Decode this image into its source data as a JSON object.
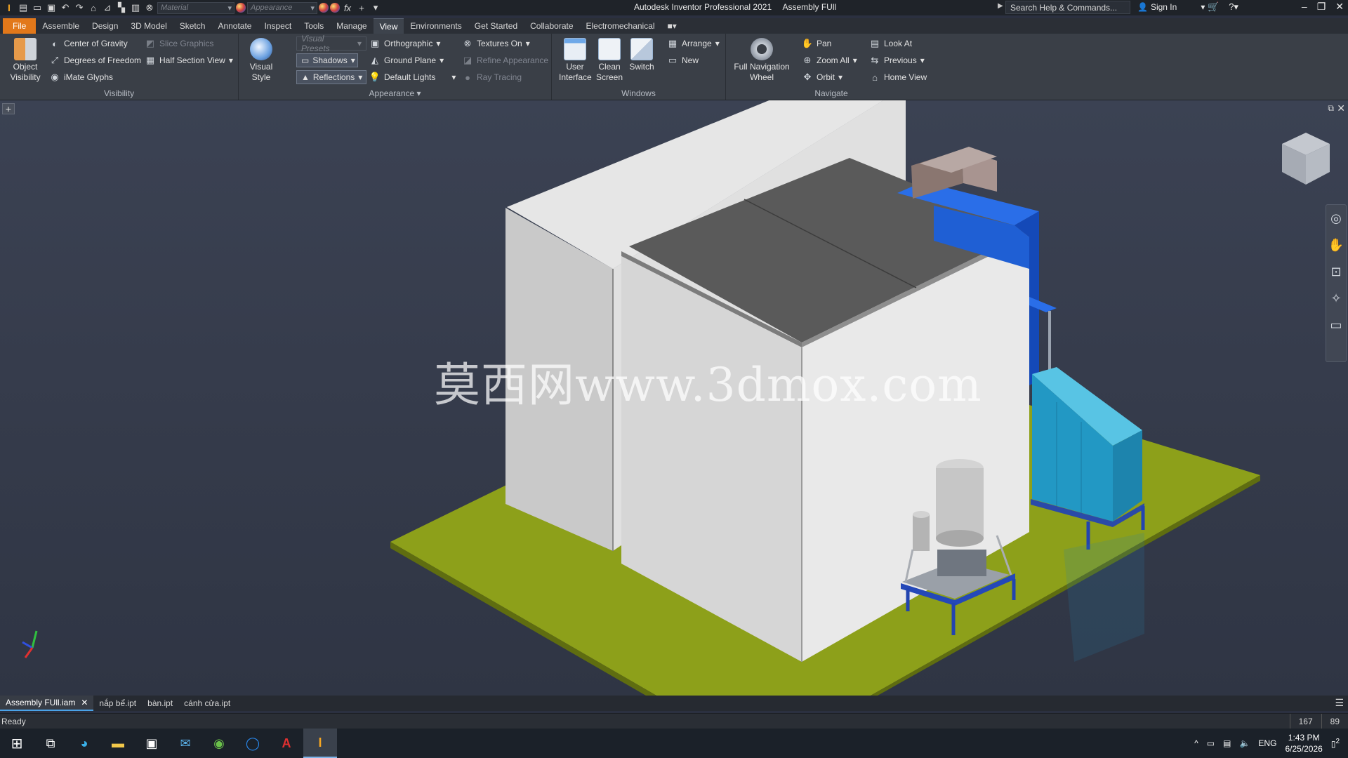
{
  "app": {
    "title": "Autodesk Inventor Professional 2021",
    "document": "Assembly FUll",
    "search_placeholder": "Search Help & Commands...",
    "sign_in": "Sign In",
    "quick_access": {
      "material_value": "Material",
      "appearance_value": "Appearance",
      "fx_label": "fx"
    }
  },
  "menu": {
    "tabs": [
      "File",
      "Assemble",
      "Design",
      "3D Model",
      "Sketch",
      "Annotate",
      "Inspect",
      "Tools",
      "Manage",
      "View",
      "Environments",
      "Get Started",
      "Collaborate",
      "Electromechanical"
    ],
    "active_tab": "View"
  },
  "ribbon": {
    "visibility": {
      "title": "Visibility",
      "object_visibility": "Object Visibility",
      "center_of_gravity": "Center of Gravity",
      "degrees_of_freedom": "Degrees of Freedom",
      "imate_glyphs": "iMate Glyphs",
      "slice_graphics": "Slice Graphics",
      "half_section_view": "Half Section View"
    },
    "appearance": {
      "title": "Appearance",
      "visual_style": "Visual Style",
      "visual_presets": "Visual Presets",
      "shadows": "Shadows",
      "reflections": "Reflections",
      "orthographic": "Orthographic",
      "ground_plane": "Ground Plane",
      "default_lights": "Default Lights",
      "textures_on": "Textures On",
      "refine_appearance": "Refine Appearance",
      "ray_tracing": "Ray Tracing"
    },
    "windows": {
      "title": "Windows",
      "user_interface": "User Interface",
      "clean_screen": "Clean Screen",
      "switch": "Switch",
      "arrange": "Arrange",
      "new": "New"
    },
    "navigate": {
      "title": "Navigate",
      "full_navigation_wheel": "Full Navigation Wheel",
      "pan": "Pan",
      "zoom_all": "Zoom All",
      "orbit": "Orbit",
      "look_at": "Look At",
      "previous": "Previous",
      "home_view": "Home View"
    }
  },
  "viewport": {
    "watermark": "莫西网www.3dmox.com"
  },
  "doc_tabs": [
    {
      "label": "Assembly FUll.iam",
      "active": true
    },
    {
      "label": "nắp bể.ipt",
      "active": false
    },
    {
      "label": "bàn.ipt",
      "active": false
    },
    {
      "label": "cánh cửa.ipt",
      "active": false
    }
  ],
  "status": {
    "text": "Ready",
    "count_a": "167",
    "count_b": "89"
  },
  "taskbar": {
    "language": "ENG",
    "time": "1:43 PM",
    "date": "6/25/2026",
    "notification_count": "2"
  },
  "colors": {
    "accent": "#e2781a",
    "ribbon_bg": "#3a3f47",
    "ground": "#8da01a",
    "blue_equipment": "#1a5fd0",
    "cyan_equipment": "#29a8d0"
  }
}
